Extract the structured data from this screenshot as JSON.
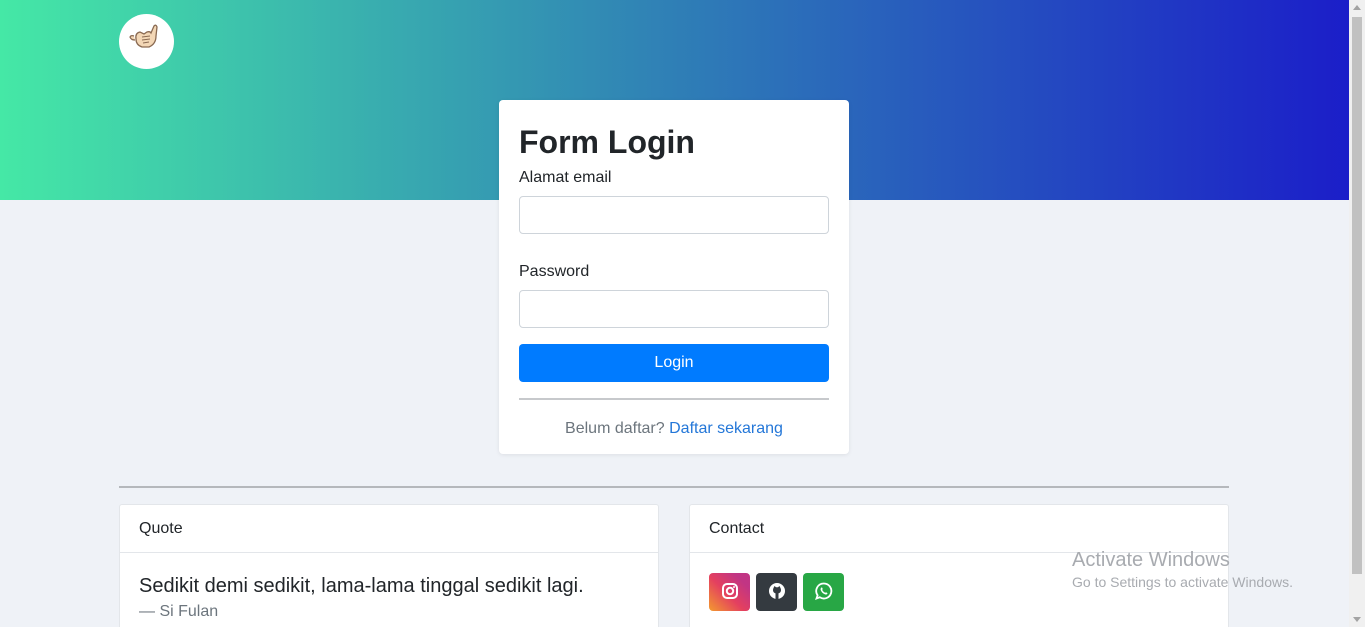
{
  "header": {
    "logo_icon": "shaka-hand-icon"
  },
  "login": {
    "title": "Form Login",
    "email_label": "Alamat email",
    "email_value": "",
    "password_label": "Password",
    "password_value": "",
    "submit_label": "Login",
    "signup_prompt": "Belum daftar?",
    "signup_link": "Daftar sekarang"
  },
  "quote": {
    "header": "Quote",
    "text": "Sedikit demi sedikit, lama-lama tinggal sedikit lagi.",
    "author": "— Si Fulan"
  },
  "contact": {
    "header": "Contact",
    "buttons": [
      {
        "icon": "instagram-icon",
        "color": "#e4405f"
      },
      {
        "icon": "github-icon",
        "color": "#343a40"
      },
      {
        "icon": "whatsapp-icon",
        "color": "#28a745"
      }
    ]
  },
  "watermark": {
    "title": "Activate Windows",
    "subtitle": "Go to Settings to activate Windows."
  },
  "colors": {
    "primary": "#007bff",
    "gradient_start": "#45e8a6",
    "gradient_end": "#1b1ec9",
    "link": "#2477d8"
  }
}
